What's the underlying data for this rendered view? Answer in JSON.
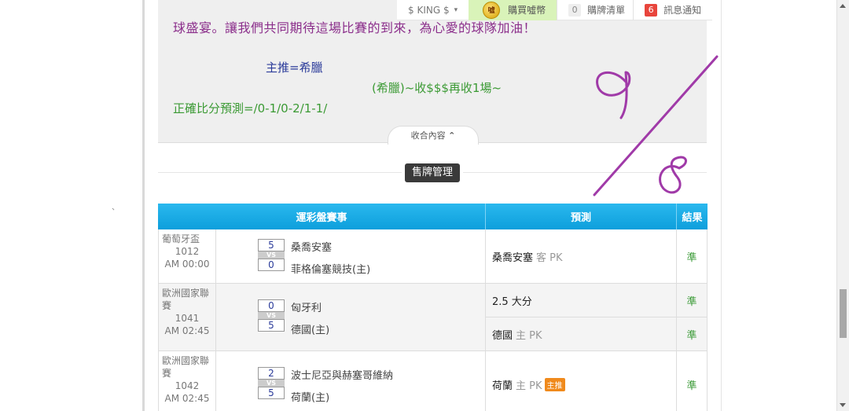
{
  "topbar": {
    "user": "$ KING $",
    "buy_coins": "購買噓幣",
    "coin_glyph": "噓",
    "cart_count": "0",
    "cart_label": "購牌清單",
    "notify_count": "6",
    "notify_label": "訊息通知"
  },
  "article": {
    "line1": "球盛宴。讓我們共同期待這場比賽的到來，為心愛的球隊加油！",
    "recommend": "主推=希臘",
    "green1": "(希臘)~收$$$再收1場~",
    "green2": "正確比分預測=/0-1/0-2/1-1/",
    "collapse": "收合內容"
  },
  "section": {
    "button": "售牌管理"
  },
  "table": {
    "headers": [
      "運彩盤賽事",
      "預測",
      "結果"
    ],
    "rows": [
      {
        "league": "葡萄牙盃",
        "num": "1012",
        "time": "AM 00:00",
        "team1": "桑喬安塞",
        "score1": "5",
        "team2": "菲格倫塞競技(主)",
        "score2": "0",
        "vs": "VS",
        "preds": [
          {
            "team": "桑喬安塞",
            "side": "客 PK",
            "tag": ""
          }
        ],
        "results": [
          "準"
        ]
      },
      {
        "league": "歐洲國家聯賽",
        "num": "1041",
        "time": "AM 02:45",
        "team1": "匈牙利",
        "score1": "0",
        "team2": "德國(主)",
        "score2": "5",
        "vs": "VS",
        "preds": [
          {
            "team": "2.5 大分",
            "side": "",
            "tag": ""
          },
          {
            "team": "德國",
            "side": "主 PK",
            "tag": ""
          }
        ],
        "results": [
          "準",
          "準"
        ]
      },
      {
        "league": "歐洲國家聯賽",
        "num": "1042",
        "time": "AM 02:45",
        "team1": "波士尼亞與赫塞哥維納",
        "score1": "2",
        "team2": "荷蘭(主)",
        "score2": "5",
        "vs": "VS",
        "preds": [
          {
            "team": "荷蘭",
            "side": "主 PK",
            "tag": "主推"
          }
        ],
        "results": [
          "準"
        ]
      }
    ]
  },
  "annotation": {
    "color": "#a03aa8"
  },
  "stray_mark": "、"
}
